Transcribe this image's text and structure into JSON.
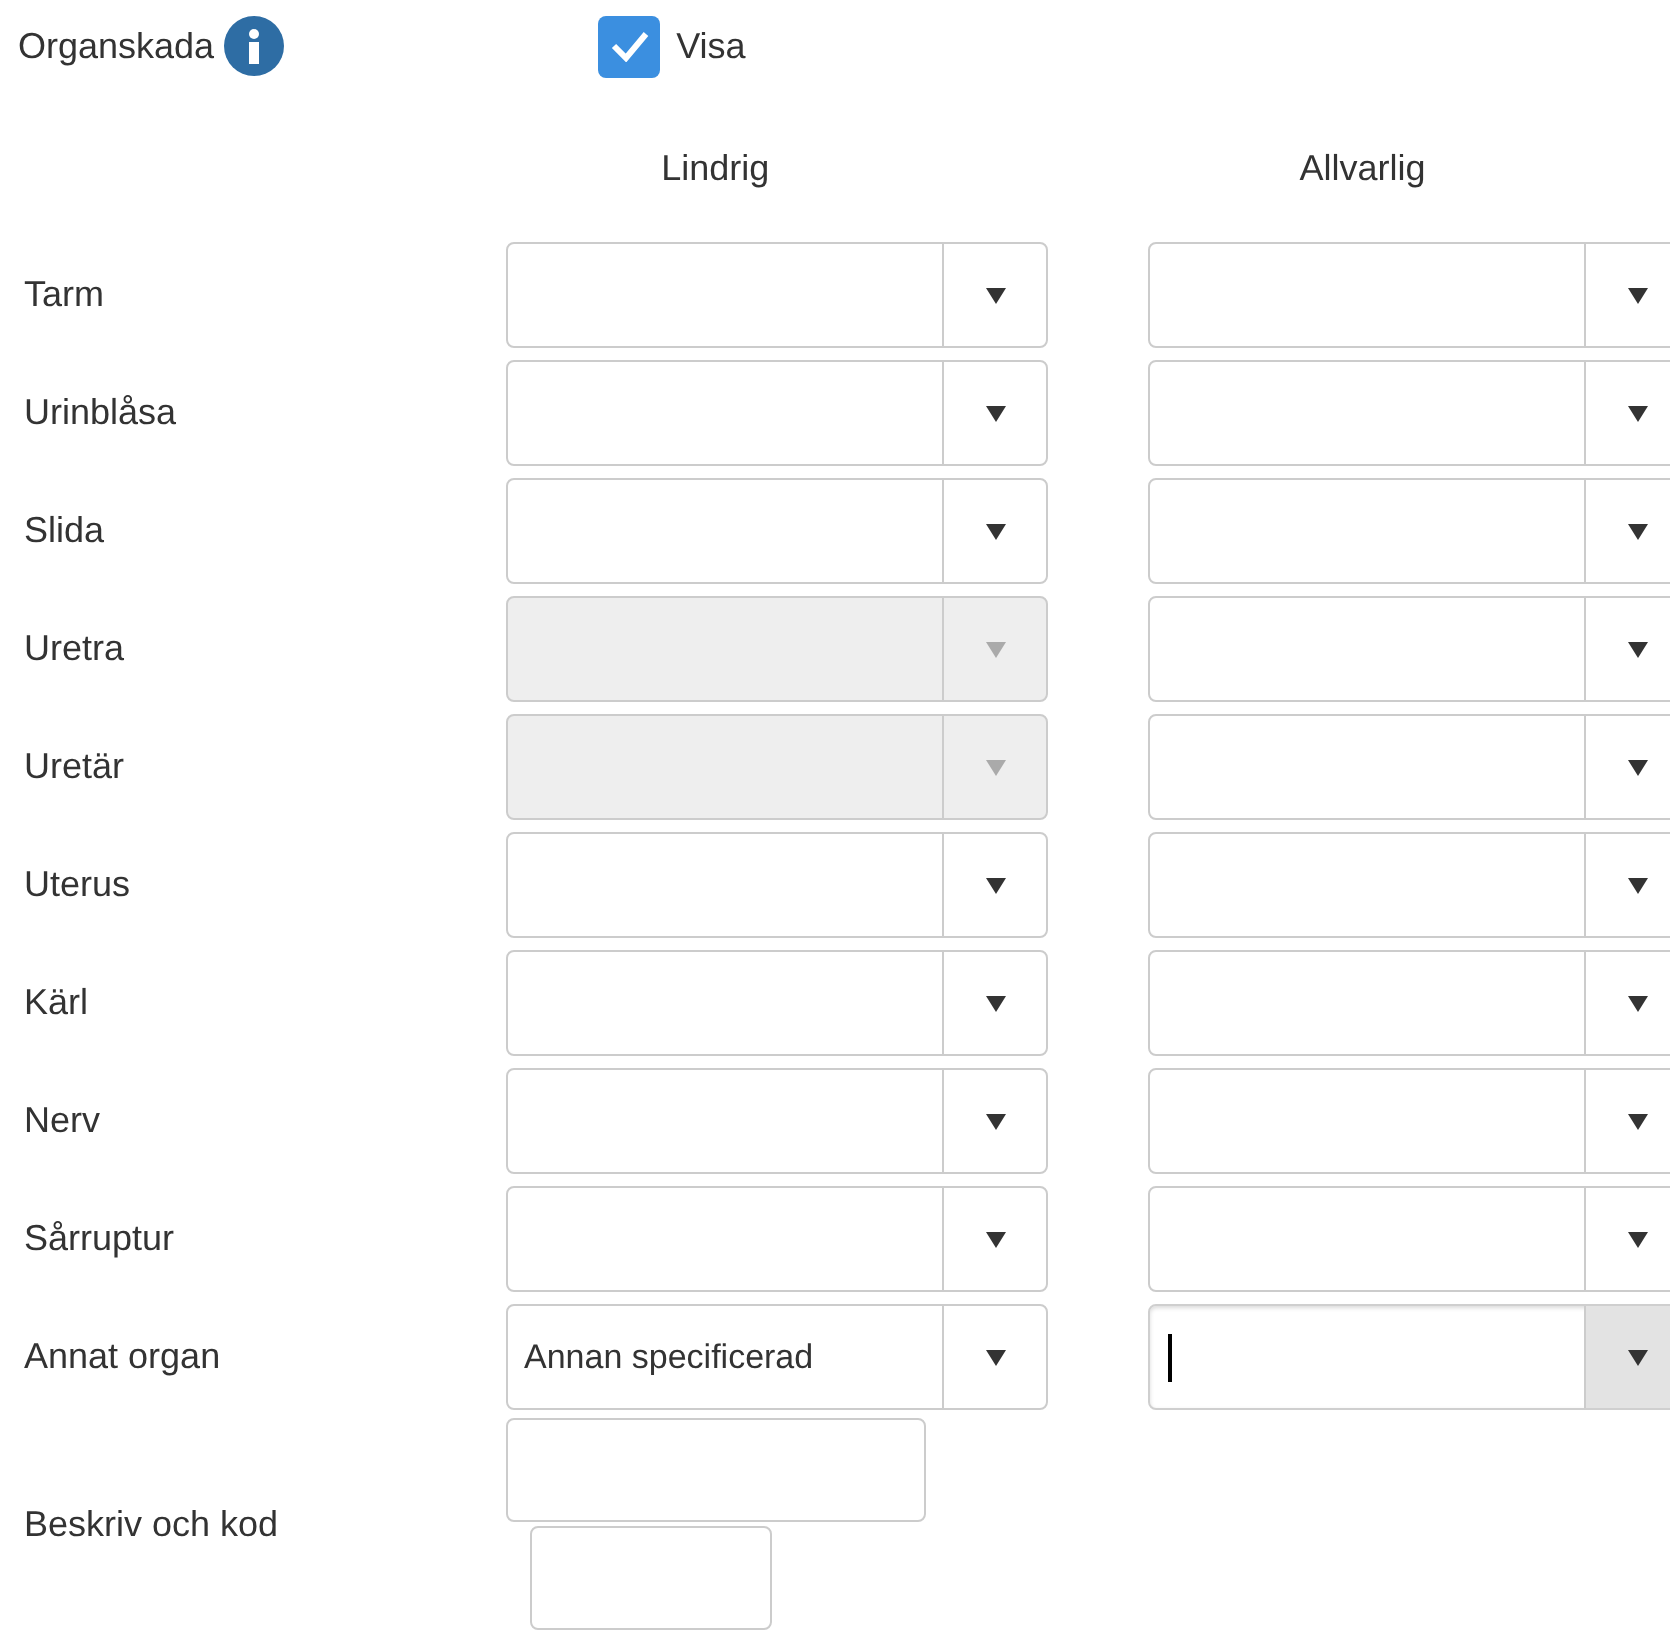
{
  "section": {
    "title": "Organskada",
    "show_checkbox": {
      "label": "Visa",
      "checked": true
    }
  },
  "columns": [
    "Lindrig",
    "Allvarlig"
  ],
  "rows": [
    {
      "label": "Tarm",
      "selects": [
        {
          "disabled": false
        },
        {
          "disabled": false
        }
      ]
    },
    {
      "label": "Urinblåsa",
      "selects": [
        {
          "disabled": false
        },
        {
          "disabled": false
        }
      ]
    },
    {
      "label": "Slida",
      "selects": [
        {
          "disabled": false
        },
        {
          "disabled": false
        }
      ]
    },
    {
      "label": "Uretra",
      "selects": [
        {
          "disabled": true
        },
        {
          "disabled": false
        }
      ]
    },
    {
      "label": "Uretär",
      "selects": [
        {
          "disabled": true
        },
        {
          "disabled": false
        }
      ]
    },
    {
      "label": "Uterus",
      "selects": [
        {
          "disabled": false
        },
        {
          "disabled": false
        }
      ]
    },
    {
      "label": "Kärl",
      "selects": [
        {
          "disabled": false
        },
        {
          "disabled": false
        }
      ]
    },
    {
      "label": "Nerv",
      "selects": [
        {
          "disabled": false
        },
        {
          "disabled": false
        }
      ]
    },
    {
      "label": "Sårruptur",
      "selects": [
        {
          "disabled": false
        },
        {
          "disabled": false
        }
      ]
    },
    {
      "label": "Annat organ",
      "selects": [
        {
          "disabled": false,
          "value": "Annan specificerad"
        },
        {
          "disabled": false,
          "focused": true
        }
      ]
    }
  ],
  "describe": {
    "label": "Beskriv och kod"
  }
}
